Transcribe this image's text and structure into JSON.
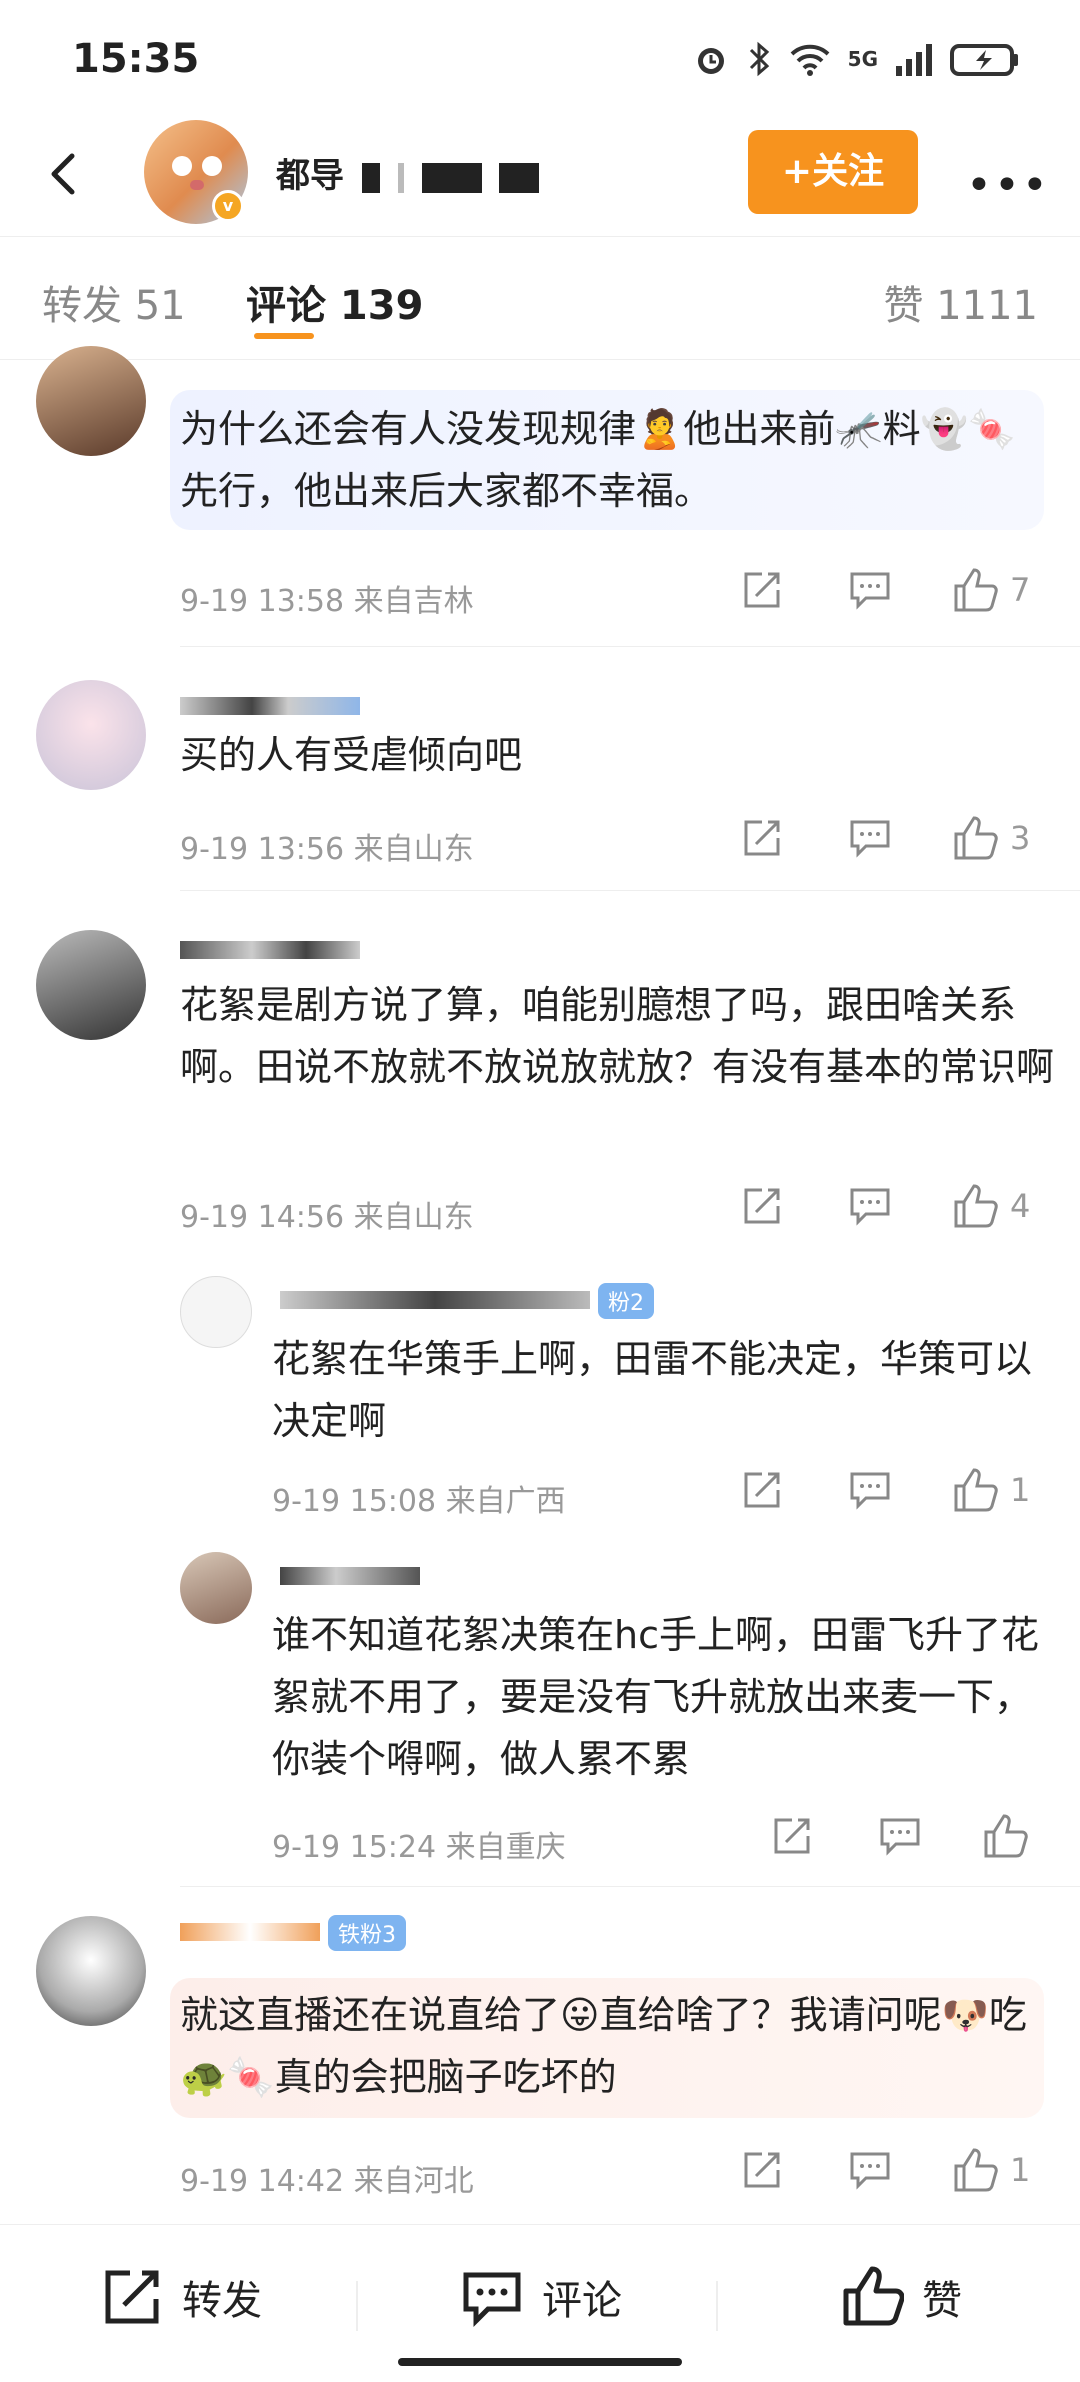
{
  "status_bar": {
    "time": "15:35",
    "network": "5G"
  },
  "header": {
    "username": "都导",
    "follow_label": "+关注",
    "more_label": "•••"
  },
  "tabs": {
    "forward": "转发 51",
    "comment": "评论 139",
    "like": "赞 1111"
  },
  "comments": [
    {
      "name": "",
      "text": "为什么还会有人没发现规律🙎他出来前🦟料👻🍬先行，他出来后大家都不幸福。",
      "time": "9-19 13:58",
      "location": "来自吉林",
      "likes": "7"
    },
    {
      "name": "",
      "text": "买的人有受虐倾向吧",
      "time": "9-19 13:56",
      "location": "来自山东",
      "likes": "3"
    },
    {
      "name": "",
      "text": "花絮是剧方说了算，咱能别臆想了吗，跟田啥关系啊。田说不放就不放说放就放？有没有基本的常识啊",
      "time": "9-19 14:56",
      "location": "来自山东",
      "likes": "4",
      "replies": [
        {
          "name": "",
          "badge": "粉2",
          "text": "花絮在华策手上啊，田雷不能决定，华策可以决定啊",
          "time": "9-19 15:08",
          "location": "来自广西",
          "likes": "1"
        },
        {
          "name": "",
          "text": "谁不知道花絮决策在hc手上啊，田雷飞升了花絮就不用了，要是没有飞升就放出来麦一下，你装个嘚啊，做人累不累",
          "time": "9-19 15:24",
          "location": "来自重庆",
          "likes": ""
        }
      ]
    },
    {
      "name": "",
      "badge": "铁粉3",
      "text": "就这直播还在说直给了😛直给啥了？我请问呢🐶吃🐢🍬真的会把脑子吃坏的",
      "time": "9-19 14:42",
      "location": "来自河北",
      "likes": "1"
    }
  ],
  "bottom_bar": {
    "forward": "转发",
    "comment": "评论",
    "like": "赞"
  },
  "colors": {
    "accent": "#f7931e",
    "fan_badge": "#7eb4f0"
  }
}
